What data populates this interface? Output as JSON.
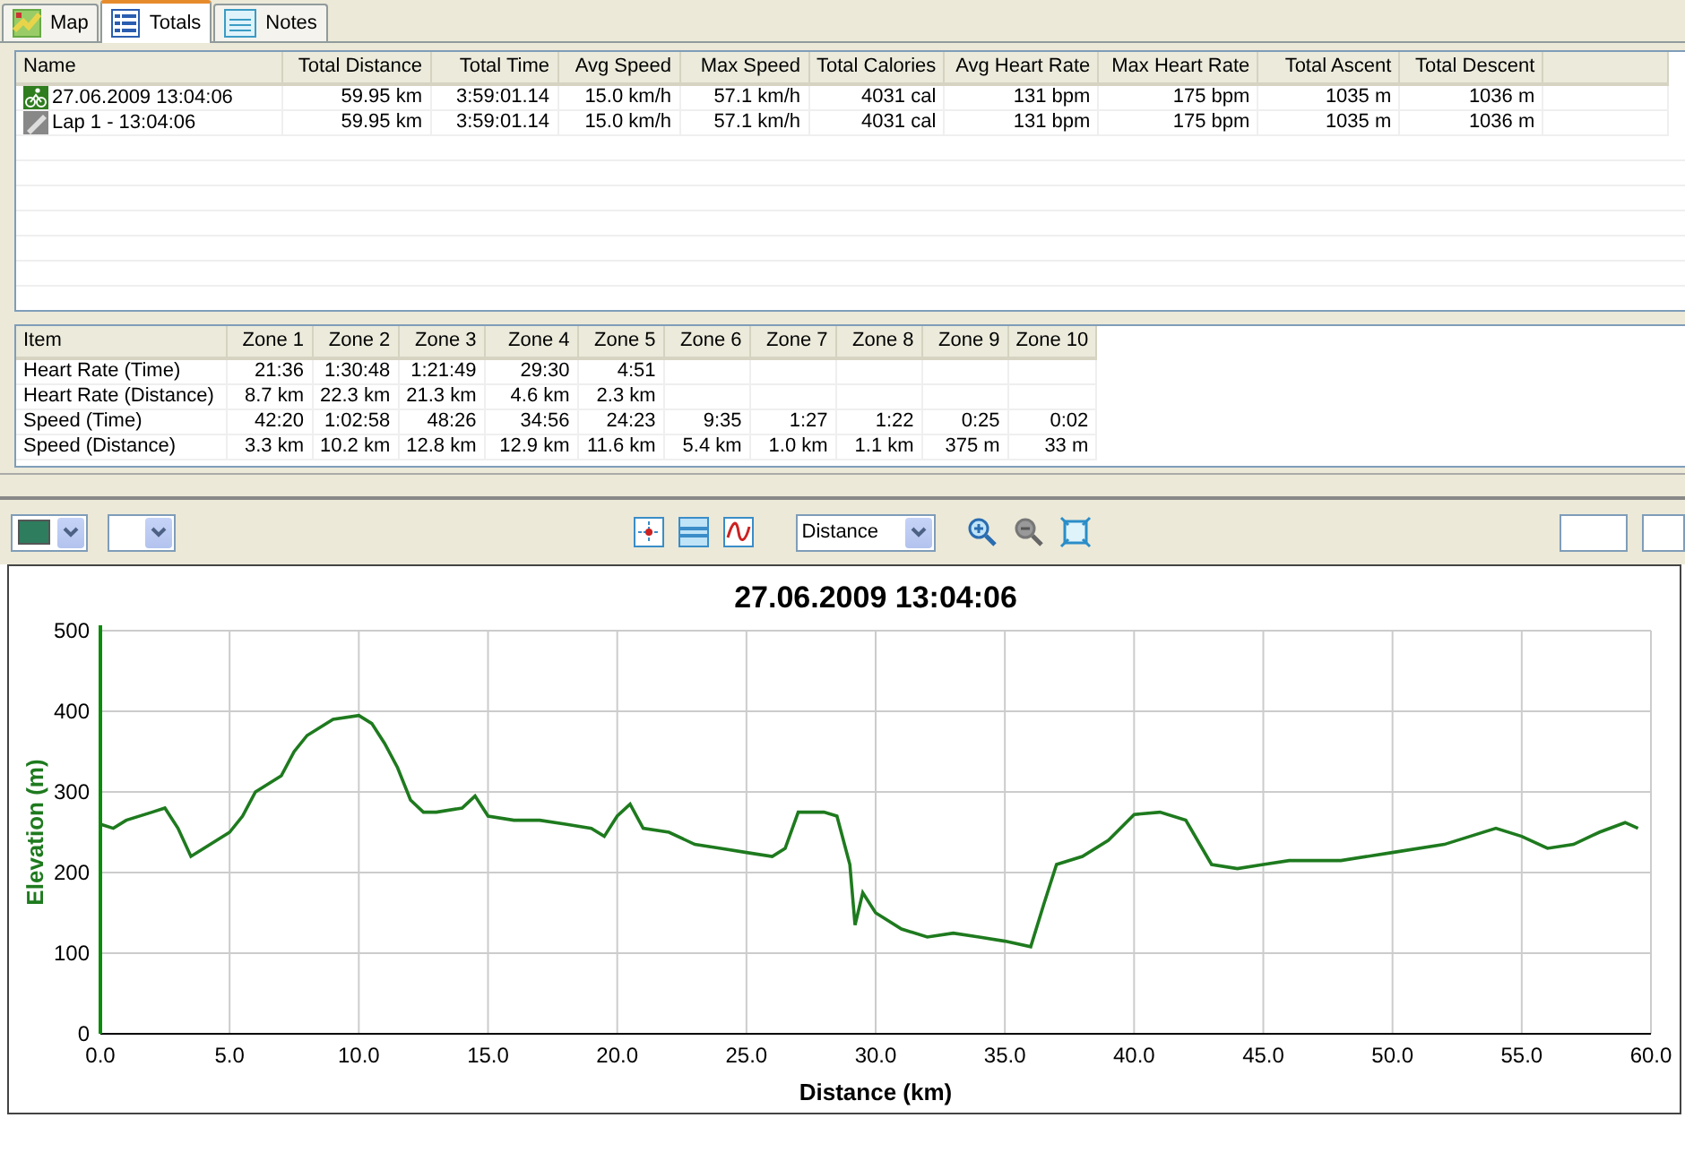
{
  "tabs": [
    {
      "label": "Map",
      "selected": false,
      "kind": "map"
    },
    {
      "label": "Totals",
      "selected": true,
      "kind": "totals"
    },
    {
      "label": "Notes",
      "selected": false,
      "kind": "notes"
    }
  ],
  "totals_table": {
    "columns": [
      "Name",
      "Total Distance",
      "Total Time",
      "Avg Speed",
      "Max Speed",
      "Total Calories",
      "Avg Heart Rate",
      "Max Heart Rate",
      "Total Ascent",
      "Total Descent"
    ],
    "rows": [
      {
        "kind": "activity",
        "cells": [
          "27.06.2009 13:04:06",
          "59.95 km",
          "3:59:01.14",
          "15.0 km/h",
          "57.1 km/h",
          "4031 cal",
          "131 bpm",
          "175 bpm",
          "1035 m",
          "1036 m"
        ]
      },
      {
        "kind": "lap",
        "cells": [
          "Lap 1 - 13:04:06",
          "59.95 km",
          "3:59:01.14",
          "15.0 km/h",
          "57.1 km/h",
          "4031 cal",
          "131 bpm",
          "175 bpm",
          "1035 m",
          "1036 m"
        ]
      }
    ]
  },
  "zones_table": {
    "columns": [
      "Item",
      "Zone 1",
      "Zone 2",
      "Zone 3",
      "Zone 4",
      "Zone 5",
      "Zone 6",
      "Zone 7",
      "Zone 8",
      "Zone 9",
      "Zone 10"
    ],
    "rows": [
      [
        "Heart Rate (Time)",
        "21:36",
        "1:30:48",
        "1:21:49",
        "29:30",
        "4:51",
        null,
        null,
        null,
        null,
        null
      ],
      [
        "Heart Rate (Distance)",
        "8.7 km",
        "22.3 km",
        "21.3 km",
        "4.6 km",
        "2.3 km",
        null,
        null,
        null,
        null,
        null
      ],
      [
        "Speed (Time)",
        "42:20",
        "1:02:58",
        "48:26",
        "34:56",
        "24:23",
        "9:35",
        "1:27",
        "1:22",
        "0:25",
        "0:02"
      ],
      [
        "Speed (Distance)",
        "3.3 km",
        "10.2 km",
        "12.8 km",
        "12.9 km",
        "11.6 km",
        "5.4 km",
        "1.0 km",
        "1.1 km",
        "375 m",
        "33 m"
      ]
    ]
  },
  "toolbar": {
    "x_axis": "Distance"
  },
  "chart": {
    "title": "27.06.2009 13:04:06",
    "chart_data": {
      "type": "line",
      "xlabel": "Distance (km)",
      "ylabel": "Elevation (m)",
      "xlim": [
        0,
        60
      ],
      "ylim": [
        0,
        500
      ],
      "xticks": [
        {
          "value": 0,
          "label": "0.0"
        },
        {
          "value": 5,
          "label": "5.0"
        },
        {
          "value": 10,
          "label": "10.0"
        },
        {
          "value": 15,
          "label": "15.0"
        },
        {
          "value": 20,
          "label": "20.0"
        },
        {
          "value": 25,
          "label": "25.0"
        },
        {
          "value": 30,
          "label": "30.0"
        },
        {
          "value": 35,
          "label": "35.0"
        },
        {
          "value": 40,
          "label": "40.0"
        },
        {
          "value": 45,
          "label": "45.0"
        },
        {
          "value": 50,
          "label": "50.0"
        },
        {
          "value": 55,
          "label": "55.0"
        },
        {
          "value": 60,
          "label": "60.0"
        }
      ],
      "yticks": [
        0,
        100,
        200,
        300,
        400,
        500
      ],
      "grid": true,
      "x": [
        0,
        0.5,
        1,
        2,
        2.5,
        3,
        3.5,
        4,
        5,
        5.5,
        6,
        7,
        7.5,
        8,
        9,
        10,
        10.5,
        11,
        11.5,
        12,
        12.5,
        13,
        14,
        14.5,
        15,
        16,
        17,
        18,
        19,
        19.5,
        20,
        20.5,
        21,
        22,
        23,
        24,
        25,
        26,
        26.5,
        27,
        28,
        28.5,
        29,
        29.2,
        29.5,
        30,
        31,
        32,
        33,
        34,
        35,
        36,
        36.5,
        37,
        38,
        39,
        40,
        41,
        42,
        43,
        44,
        45,
        46,
        48,
        50,
        52,
        54,
        55,
        56,
        57,
        58,
        59,
        59.5
      ],
      "series": [
        {
          "color": "#1e7a1e",
          "values": [
            260,
            255,
            265,
            275,
            280,
            255,
            220,
            230,
            250,
            270,
            300,
            320,
            350,
            370,
            390,
            395,
            385,
            360,
            330,
            290,
            275,
            275,
            280,
            295,
            270,
            265,
            265,
            260,
            255,
            245,
            270,
            285,
            255,
            250,
            235,
            230,
            225,
            220,
            230,
            275,
            275,
            270,
            210,
            135,
            175,
            150,
            130,
            120,
            125,
            120,
            115,
            108,
            160,
            210,
            220,
            240,
            272,
            275,
            265,
            210,
            205,
            210,
            215,
            215,
            225,
            235,
            255,
            245,
            230,
            235,
            250,
            262,
            255
          ]
        }
      ]
    }
  }
}
